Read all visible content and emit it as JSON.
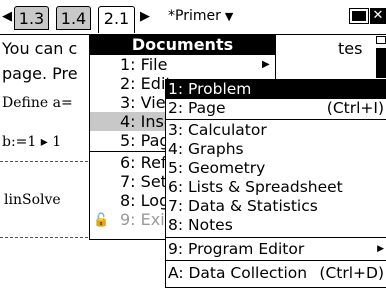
{
  "tabs": [
    "1.3",
    "1.4",
    "2.1"
  ],
  "doc_title": "*Primer",
  "doc_text": {
    "line1_left": "You can c",
    "line1_right": "tes",
    "line2": "page. Pre",
    "define": "Define a=",
    "b_expr": "b:=1 ▸ 1",
    "linsolve": "linSolve"
  },
  "documents_menu": {
    "title": "Documents",
    "items": [
      {
        "num": "1:",
        "label": "File"
      },
      {
        "num": "2:",
        "label": "Edit"
      },
      {
        "num": "3:",
        "label": "View"
      },
      {
        "num": "4:",
        "label": "Insert"
      },
      {
        "num": "5:",
        "label": "Page"
      },
      {
        "num": "6:",
        "label": "Refresh"
      },
      {
        "num": "7:",
        "label": "Settings"
      },
      {
        "num": "8:",
        "label": "Log"
      },
      {
        "num": "9:",
        "label": "Exit"
      }
    ]
  },
  "insert_submenu": [
    {
      "label": "1: Problem",
      "shortcut": ""
    },
    {
      "label": "2: Page",
      "shortcut": "(Ctrl+I)"
    },
    {
      "label": "3: Calculator",
      "shortcut": ""
    },
    {
      "label": "4: Graphs",
      "shortcut": ""
    },
    {
      "label": "5: Geometry",
      "shortcut": ""
    },
    {
      "label": "6: Lists & Spreadsheet",
      "shortcut": ""
    },
    {
      "label": "7: Data & Statistics",
      "shortcut": ""
    },
    {
      "label": "8: Notes",
      "shortcut": ""
    },
    {
      "label": "9: Program Editor",
      "shortcut": ""
    },
    {
      "label": "A: Data Collection",
      "shortcut": "(Ctrl+D)"
    }
  ]
}
